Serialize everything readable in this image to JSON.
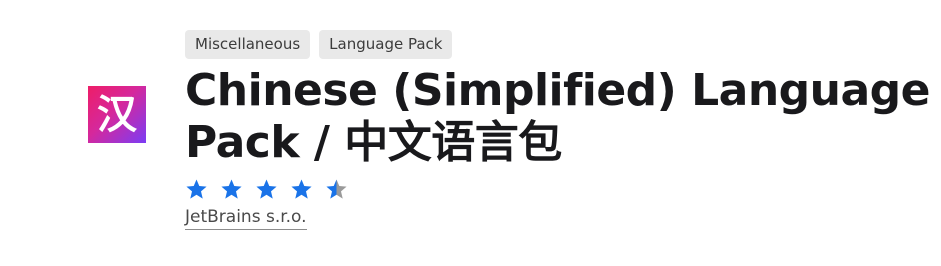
{
  "plugin": {
    "icon_glyph": "汉",
    "icon_name": "chinese-character-icon",
    "tags": [
      "Miscellaneous",
      "Language Pack"
    ],
    "title": "Chinese (Simplified) Language Pack / 中文语言包",
    "rating": {
      "value": 4.5,
      "max": 5
    },
    "vendor": "JetBrains s.r.o."
  },
  "colors": {
    "star_filled": "#1a73e8",
    "star_empty": "#9a9a9a",
    "icon_gradient": [
      "#ee1d67",
      "#d5289c",
      "#7b3cf5"
    ]
  }
}
